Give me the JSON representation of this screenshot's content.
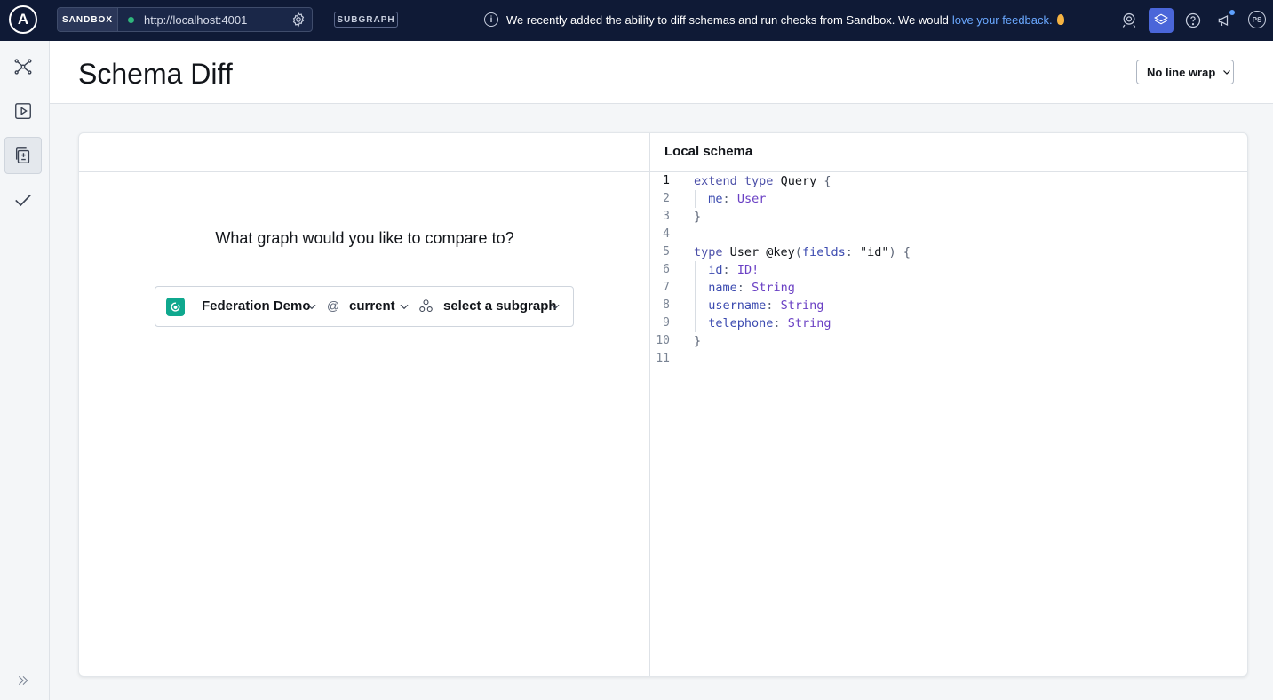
{
  "topbar": {
    "logo_letter": "A",
    "sandbox_label": "SANDBOX",
    "endpoint_url": "http://localhost:4001",
    "subgraph_label": "SUBGRAPH",
    "notice_text": "We recently added the ability to diff schemas and run checks from Sandbox. We would",
    "notice_link": "love your feedback.",
    "avatar_initials": "PS"
  },
  "header": {
    "title": "Schema Diff",
    "line_wrap_option": "No line wrap"
  },
  "left_pane": {
    "prompt": "What graph would you like to compare to?",
    "graph_name": "Federation Demo",
    "at_symbol": "@",
    "variant": "current",
    "subgraph_placeholder": "select a subgraph"
  },
  "right_pane": {
    "title": "Local schema",
    "line_numbers": [
      "1",
      "2",
      "3",
      "4",
      "5",
      "6",
      "7",
      "8",
      "9",
      "10",
      "11"
    ]
  },
  "colors": {
    "topbar_bg": "#0f1a36",
    "accent": "#4a66d9",
    "link": "#6aa8ff",
    "status_green": "#2fb67c",
    "graph_logo": "#0fa88e"
  },
  "icons": {
    "sidebar": [
      "graph-icon",
      "play-icon",
      "schema-diff-icon",
      "checks-icon",
      "expand-icon"
    ],
    "topbar": [
      "settings-icon",
      "info-icon",
      "ai-icon",
      "layers-icon",
      "help-icon",
      "announcement-icon"
    ]
  }
}
